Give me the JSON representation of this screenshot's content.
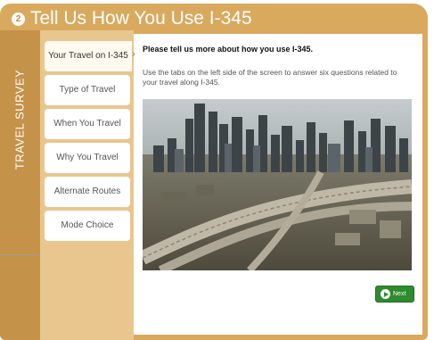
{
  "header": {
    "step_number": "2",
    "title": "Tell Us How You Use I-345"
  },
  "sidebar": {
    "vertical_title": "TRAVEL SURVEY",
    "items": [
      {
        "label": "Your Travel on I-345",
        "active": true
      },
      {
        "label": "Type of Travel"
      },
      {
        "label": "When You Travel"
      },
      {
        "label": "Why You Travel"
      },
      {
        "label": "Alternate Routes"
      },
      {
        "label": "Mode Choice"
      }
    ]
  },
  "content": {
    "title": "Please tell us more about how you use I-345.",
    "instructions": "Use the tabs on the left side of the screen to answer six questions related to your travel along I-345."
  },
  "footer": {
    "next_label": "Next"
  },
  "colors": {
    "frame": "#d9a95e",
    "sidebar": "#e8c68e",
    "next_button": "#2e8b2e"
  }
}
